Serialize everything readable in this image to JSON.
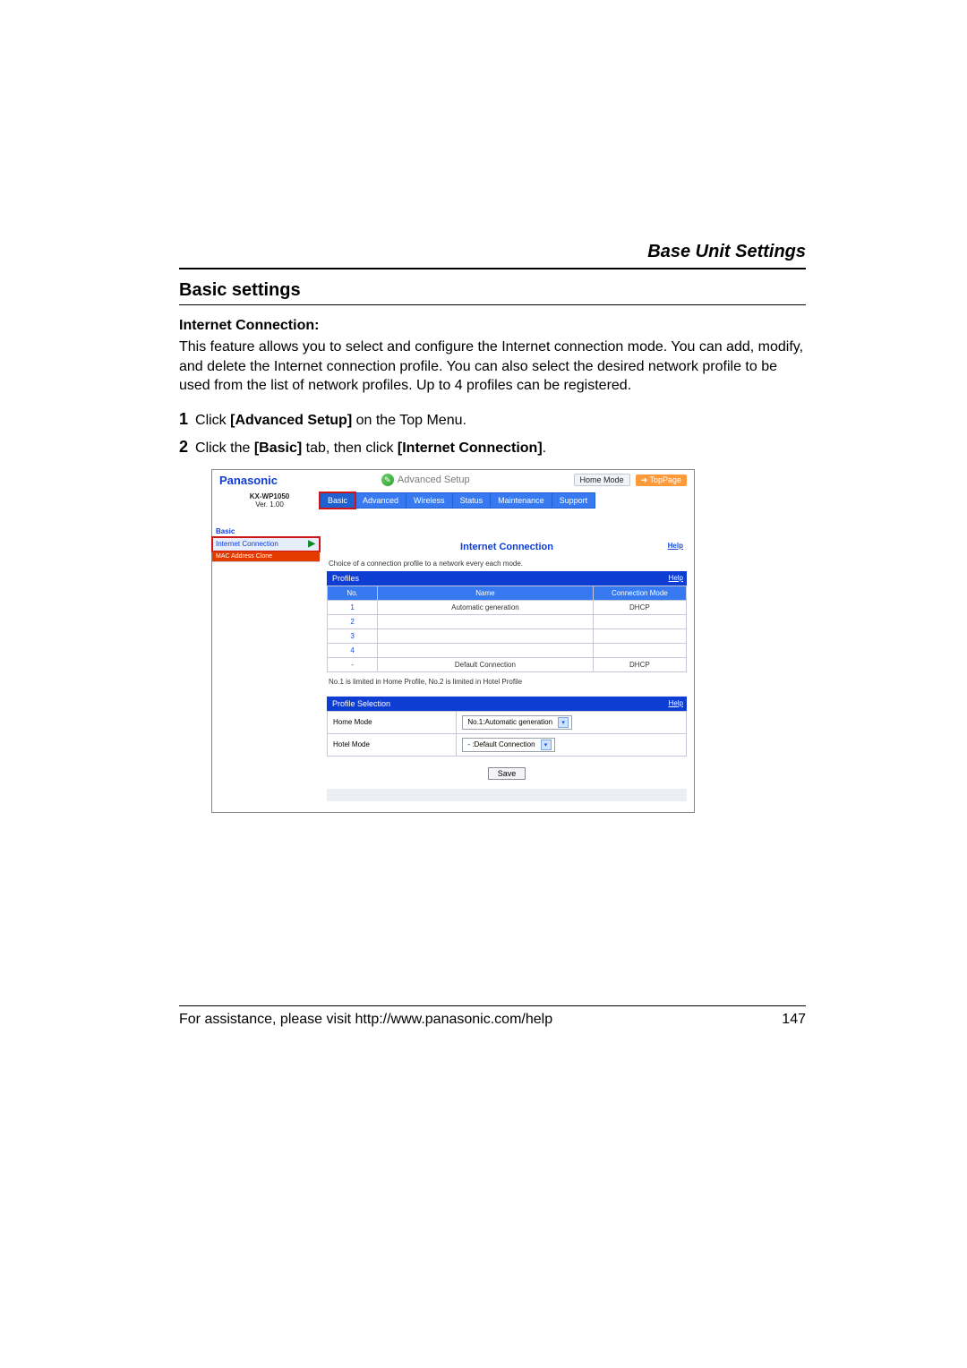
{
  "header": {
    "title": "Base Unit Settings"
  },
  "section": {
    "heading": "Basic settings",
    "sub": "Internet Connection:",
    "para": "This feature allows you to select and configure the Internet connection mode.\nYou can add, modify, and delete the Internet connection profile. You can also select the desired network profile to be used from the list of network profiles. Up to 4 profiles can be registered."
  },
  "steps": [
    {
      "num": "1",
      "pre": "Click ",
      "bold": "[Advanced Setup]",
      "post": " on the Top Menu."
    },
    {
      "num": "2",
      "pre": "Click the ",
      "bold1": "[Basic]",
      "mid": " tab, then click ",
      "bold2": "[Internet Connection]",
      "post": "."
    }
  ],
  "embedded": {
    "brand": "Panasonic",
    "adv_setup_label": "Advanced Setup",
    "mode_label": "Home Mode",
    "top_page": "TopPage",
    "model": "KX-WP1050",
    "version": "Ver. 1.00",
    "tabs": [
      "Basic",
      "Advanced",
      "Wireless",
      "Status",
      "Maintenance",
      "Support"
    ],
    "sidebar": {
      "header": "Basic",
      "active_item": "Internet Connection",
      "dim_item": "MAC Address Clone"
    },
    "main_title": "Internet Connection",
    "help": "Help",
    "caption": "Choice of a connection profile to a network every each mode.",
    "profiles_label": "Profiles",
    "table": {
      "headers": [
        "No.",
        "Name",
        "Connection Mode"
      ],
      "rows": [
        {
          "no": "1",
          "name": "Automatic generation",
          "mode": "DHCP"
        },
        {
          "no": "2",
          "name": "",
          "mode": ""
        },
        {
          "no": "3",
          "name": "",
          "mode": ""
        },
        {
          "no": "4",
          "name": "",
          "mode": ""
        },
        {
          "no": "-",
          "name": "Default Connection",
          "mode": "DHCP"
        }
      ]
    },
    "note": "No.1 is limited in Home Profile, No.2 is limited in Hotel Profile",
    "profile_selection_label": "Profile Selection",
    "selection": {
      "home_label": "Home Mode",
      "home_value": "No.1:Automatic generation",
      "hotel_label": "Hotel Mode",
      "hotel_value": "- :Default Connection"
    },
    "save": "Save"
  },
  "footer": {
    "text": "For assistance, please visit http://www.panasonic.com/help",
    "page": "147"
  }
}
